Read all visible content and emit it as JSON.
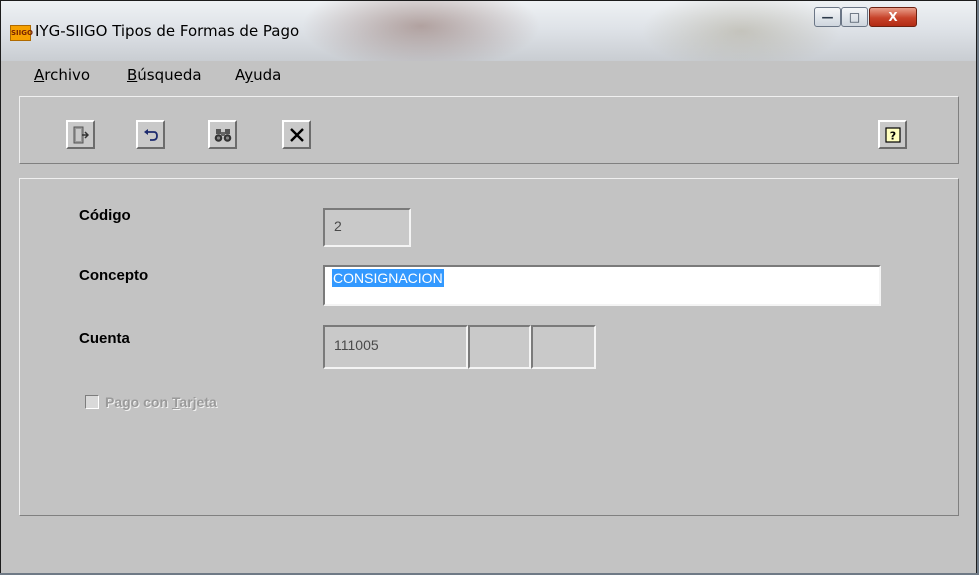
{
  "window": {
    "title": "IYG-SIIGO Tipos de Formas de Pago",
    "app_icon_text": "SIIGO",
    "controls": {
      "minimize": "—",
      "maximize": "□",
      "close": "X"
    }
  },
  "menu": {
    "archivo": {
      "mnemonic": "A",
      "rest": "rchivo"
    },
    "busqueda": {
      "mnemonic": "B",
      "rest": "úsqueda"
    },
    "ayuda": {
      "pre": "A",
      "mnemonic": "y",
      "rest": "uda"
    }
  },
  "toolbar": {
    "buttons": [
      {
        "name": "exit",
        "icon": "exit-door-icon"
      },
      {
        "name": "undo",
        "icon": "undo-arrow-icon"
      },
      {
        "name": "search",
        "icon": "binoculars-icon"
      },
      {
        "name": "delete",
        "icon": "x-delete-icon"
      },
      {
        "name": "help",
        "icon": "help-question-icon"
      }
    ]
  },
  "form": {
    "codigo_label": "Código",
    "codigo_value": "2",
    "concepto_label": "Concepto",
    "concepto_value": "CONSIGNACION",
    "cuenta_label": "Cuenta",
    "cuenta_value_1": "111005",
    "cuenta_value_2": "",
    "cuenta_value_3": "",
    "pago_label": {
      "pre": "Pago con ",
      "mnemonic": "T",
      "rest": "arjeta"
    },
    "pago_checked": false
  },
  "colors": {
    "background": "#c3c3c3",
    "selection": "#3399ff",
    "close_button": "#c7432a"
  }
}
